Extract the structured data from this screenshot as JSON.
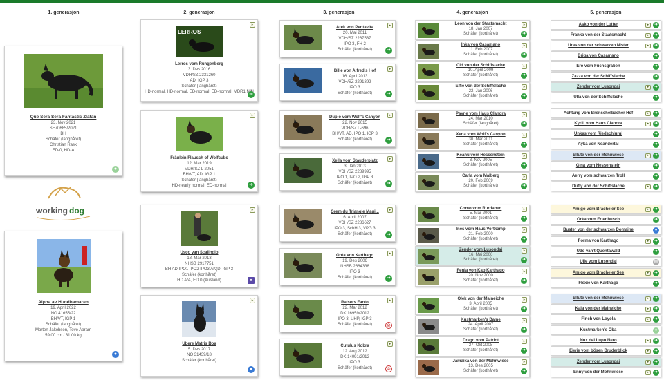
{
  "generations": [
    "1. generasjon",
    "2. generasjon",
    "3. generasjon",
    "4. generasjon",
    "5. generasjon"
  ],
  "gen1": [
    {
      "name": "Que Sera Sera Fantastic Zlatan",
      "lines": [
        "23. Nov 2021",
        "SE70685/2021",
        "BH",
        "Schäfer (langhåret)",
        "Christian Rask",
        "ED-0, HD-A"
      ],
      "badge": "green"
    },
    {
      "name": "Alpha av Hundhamaren",
      "lines": [
        "19. April 2022",
        "NO 41655/22",
        "BH/VT, IGP 1",
        "Schäfer (langhåret)",
        "Morten Jakobsen, Tove Aaram",
        "59.00 cm / 31.00 kg"
      ],
      "badge": "blue"
    }
  ],
  "logo": {
    "text1": "working",
    "text2": "dog"
  },
  "gen2": [
    {
      "name": "Lerros vom Rungenberg",
      "lines": [
        "3. Des 2016",
        "VDH/SZ 2331260",
        "AD, IGP 3",
        "Schäfer (langhåret)",
        "HD-normal, HD-normal, ED-normal, ED-normal, MDR1 N/N"
      ],
      "badge": "green",
      "logo_text": "LERROS"
    },
    {
      "name": "Fräulein Flausch of Wolfcubs",
      "lines": [
        "12. Mar 2019",
        "VDH/SZ L 2051",
        "BH/VT, AD, IGP 1",
        "Schäfer (langhåret)",
        "HD-nearly normal, ED-normal"
      ],
      "badge": "green"
    },
    {
      "name": "Usco van Scalindjo",
      "lines": [
        "18. Mar 2013",
        "NHSB 2917751",
        "BH AD IPO1 IPO2 IPO3 AK(D, IGP 3",
        "Schäfer (korthåret)",
        "HD A/A, ED 0 (Ausland)"
      ],
      "badge": "purple"
    },
    {
      "name": "Ubere Matris Boa",
      "lines": [
        "5. Des 2017",
        "NO 31439/18",
        "Schäfer (korthåret)"
      ],
      "badge": "blue"
    }
  ],
  "gen3": [
    {
      "name": "Arek von Pentavita",
      "lines": [
        "20. Mai 2011",
        "VDH/SZ 2267537",
        "IPO 3, FH 2",
        "Schäfer (korthåret)"
      ],
      "badge": "green"
    },
    {
      "name": "Bille von Alfred's Hof",
      "lines": [
        "16. April 2013",
        "VDH/SZ 2291892",
        "IPO 3",
        "Schäfer (korthåret)"
      ],
      "badge": "green"
    },
    {
      "name": "Duplo vom Wolf's Canyon",
      "lines": [
        "22. Nov 2015",
        "VDH/SZ L-696",
        "BH/VT, AD, IPO 1, IGP 3",
        "Schäfer (korthåret)"
      ],
      "badge": "green"
    },
    {
      "name": "Xella vom Stauderplatz",
      "lines": [
        "3. Jan 2013",
        "VDH/SZ 2289995",
        "IPO 1, IPO 2, IGP 3",
        "Schäfer (korthåret)"
      ],
      "badge": "green"
    },
    {
      "name": "Grem du Triangle Magi...",
      "lines": [
        "6. April 2007",
        "VDH/SZ 2286627",
        "IPO 3, SchH 3, VPG 3",
        "Schäfer (korthåret)"
      ],
      "badge": "green"
    },
    {
      "name": "Onta von Karthago",
      "lines": [
        "19. Des 2006",
        "NHSB 2664338",
        "IPO 3",
        "Schäfer (korthåret)"
      ],
      "badge": "green"
    },
    {
      "name": "Raisers Fanto",
      "lines": [
        "22. Mar 2012",
        "DK 16959/2012",
        "IPO 3, UHP, IGP 3",
        "Schäfer (korthåret)"
      ],
      "badge": "red"
    },
    {
      "name": "Cutulus Kobra",
      "lines": [
        "12. Aug 2012",
        "DK 14091/2012",
        "IPO 3",
        "Schäfer (korthåret)"
      ],
      "badge": "red"
    }
  ],
  "gen4": [
    {
      "name": "Leon von der Staatsmacht",
      "date": "18. Jan 2007",
      "breed": "Schäfer (korthåret)",
      "teal": false
    },
    {
      "name": "Inka von Casamano",
      "date": "11. Feb 2007",
      "breed": "Schäfer (korthåret)",
      "teal": false
    },
    {
      "name": "Cid von der Schiffslache",
      "date": "10. April 2009",
      "breed": "Schäfer (korthåret)",
      "teal": false
    },
    {
      "name": "Elfie von der Schiffslache",
      "date": "22. Jan 2006",
      "breed": "Schäfer (korthåret)",
      "teal": false
    },
    {
      "name": "Payne vom Haus Clanora",
      "date": "24. Mar 2010",
      "breed": "Schäfer (langhåret)",
      "teal": false
    },
    {
      "name": "Xena vom Wolf's Canyon",
      "date": "30. Mar 2011",
      "breed": "Schäfer (korthåret)",
      "teal": false
    },
    {
      "name": "Keanu vom Hessenstein",
      "date": "3. Nov 2005",
      "breed": "Schäfer (korthåret)",
      "teal": false
    },
    {
      "name": "Carla vom Malberg",
      "date": "20. Feb 2009",
      "breed": "Schäfer (korthåret)",
      "teal": false
    },
    {
      "name": "Como vom Rurdamm",
      "date": "5. Mar 2001",
      "breed": "Schäfer (korthåret)",
      "teal": false
    },
    {
      "name": "Ines vom Haus Vortkamp",
      "date": "21. Feb 2000",
      "breed": "Schäfer (korthåret)",
      "teal": false
    },
    {
      "name": "Zender vom Lusondai",
      "date": "16. Mai 2000",
      "breed": "Schäfer (korthåret)",
      "teal": true
    },
    {
      "name": "Fenja von Kap Karthago",
      "date": "20. Nov 2000",
      "breed": "Schäfer (korthåret)",
      "teal": false
    },
    {
      "name": "Olek von der Maineiche",
      "date": "3. April 2005",
      "breed": "Schäfer (korthåret)",
      "teal": false
    },
    {
      "name": "Kustmarken's Dame",
      "date": "24. April 2007",
      "breed": "Schäfer (korthåret)",
      "teal": false
    },
    {
      "name": "Drago vom Patriot",
      "date": "27. Okt 2008",
      "breed": "Schäfer (korthåret)",
      "teal": false
    },
    {
      "name": "Jamaika von der Mohnwiese",
      "date": "13. Des 2005",
      "breed": "Schäfer (korthåret)",
      "teal": false
    }
  ],
  "gen5": [
    {
      "name": "Asko von der Lutter",
      "color": "white",
      "play": true,
      "badge": "green"
    },
    {
      "name": "Franka von der Staatsmacht",
      "color": "white",
      "play": true,
      "badge": "green"
    },
    {
      "name": "Uras von der schwarzen Nister",
      "color": "white",
      "play": true,
      "badge": "green"
    },
    {
      "name": "Briga von Casamano",
      "color": "white",
      "play": false,
      "badge": "green"
    },
    {
      "name": "Ero vom Fuchsgraben",
      "color": "white",
      "play": false,
      "badge": "green"
    },
    {
      "name": "Zazza von der Schiffslache",
      "color": "white",
      "play": false,
      "badge": "green"
    },
    {
      "name": "Zender vom Lusondai",
      "color": "teal",
      "play": true,
      "badge": "green"
    },
    {
      "name": "Ulla von der Schiffslache",
      "color": "white",
      "play": false,
      "badge": "green"
    },
    {
      "name": "Achtung vom Brenschelbacher Hof",
      "color": "white",
      "play": true,
      "badge": "green"
    },
    {
      "name": "Kyrill vom Haus Clanora",
      "color": "white",
      "play": true,
      "badge": "green"
    },
    {
      "name": "Unkas vom Riedschlurgi",
      "color": "white",
      "play": false,
      "badge": "green"
    },
    {
      "name": "Ayka von Neandertal",
      "color": "white",
      "play": false,
      "badge": "green"
    },
    {
      "name": "Ellute von der Mohnwiese",
      "color": "blue",
      "play": true,
      "badge": "green"
    },
    {
      "name": "Gina vom Hessenstein",
      "color": "white",
      "play": false,
      "badge": "green"
    },
    {
      "name": "Aerry vom schwarzen Troll",
      "color": "white",
      "play": false,
      "badge": "green"
    },
    {
      "name": "Duffy von der Schiffslache",
      "color": "white",
      "play": true,
      "badge": "green"
    },
    {
      "name": "Amigo vom Bracheler See",
      "color": "yellow",
      "play": true,
      "badge": "green"
    },
    {
      "name": "Orka vom Erlenbusch",
      "color": "white",
      "play": false,
      "badge": "green"
    },
    {
      "name": "Buster von der schwarzen Domaine",
      "color": "white",
      "play": false,
      "badge": "blue"
    },
    {
      "name": "Forma von Karthago",
      "color": "white",
      "play": true,
      "badge": "green"
    },
    {
      "name": "Udo van't Quentawald",
      "color": "white",
      "play": false,
      "badge": "green"
    },
    {
      "name": "Ulle vom Lusondai",
      "color": "white",
      "play": false,
      "badge": "grey"
    },
    {
      "name": "Amigo vom Bracheler See",
      "color": "yellow",
      "play": true,
      "badge": "green"
    },
    {
      "name": "Flexie von Karthago",
      "color": "white",
      "play": false,
      "badge": "green"
    },
    {
      "name": "Ellute von der Mohnwiese",
      "color": "blue",
      "play": true,
      "badge": "green"
    },
    {
      "name": "Kaja von der Maineiche",
      "color": "white",
      "play": true,
      "badge": "green"
    },
    {
      "name": "Finch von Loyola",
      "color": "white",
      "play": true,
      "badge": "green"
    },
    {
      "name": "Kustmarken's Oba",
      "color": "white",
      "play": false,
      "badge": "pale"
    },
    {
      "name": "Nox del Lupo Nero",
      "color": "white",
      "play": true,
      "badge": "green"
    },
    {
      "name": "Eiwie vom bösen Bruderblick",
      "color": "white",
      "play": true,
      "badge": "green"
    },
    {
      "name": "Zender vom Lusondai",
      "color": "teal",
      "play": true,
      "badge": "green"
    },
    {
      "name": "Enny von der Mohnwiese",
      "color": "white",
      "play": true,
      "badge": "green"
    }
  ],
  "colors": {
    "accent": "#1a7a2a",
    "teal": "#d5ece8",
    "blue": "#dde8f5",
    "yellow": "#fdf7dc"
  }
}
